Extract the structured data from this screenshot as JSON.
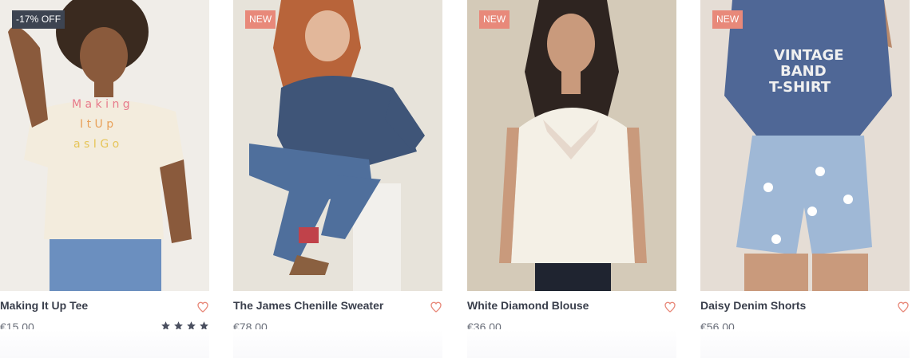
{
  "products": [
    {
      "name": "Making It Up Tee",
      "price": "€15,00",
      "badge": "-17% OFF",
      "image_icon": "tee-photo",
      "rating": 4,
      "colors": {
        "background": "#f0ede8",
        "garment": "#f3ecdd"
      }
    },
    {
      "name": "The James Chenille Sweater",
      "price": "€78,00",
      "badge": "NEW",
      "image_icon": "sweater-photo",
      "colors": {
        "background": "#e7e3da",
        "garment": "#3f5578"
      }
    },
    {
      "name": "White Diamond Blouse",
      "price": "€36,00",
      "badge": "NEW",
      "image_icon": "blouse-photo",
      "colors": {
        "background": "#d4cab8",
        "garment": "#f4f0e6"
      }
    },
    {
      "name": "Daisy Denim Shorts",
      "price": "€56,00",
      "badge": "NEW",
      "image_icon": "shorts-photo",
      "colors": {
        "background": "#e5ddd5",
        "garment": "#4f6796"
      }
    }
  ],
  "colors": {
    "sale_badge": "#3d4451",
    "new_badge": "#e8897a",
    "heart": "#e8897a",
    "star": "#4b5060",
    "title": "#3a3f4c",
    "price": "#6a6f7a"
  }
}
